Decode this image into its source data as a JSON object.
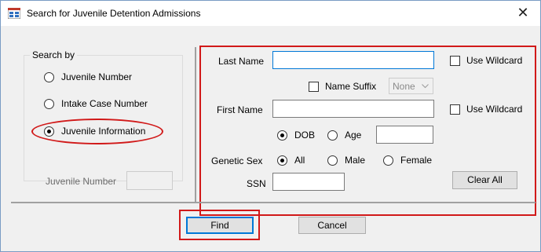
{
  "window": {
    "title": "Search for Juvenile Detention Admissions",
    "close_glyph": "✕"
  },
  "search_by": {
    "legend": "Search by",
    "options": [
      {
        "label": "Juvenile Number",
        "checked": false
      },
      {
        "label": "Intake Case Number",
        "checked": false
      },
      {
        "label": "Juvenile Information",
        "checked": true
      }
    ],
    "juvenile_number_label": "Juvenile Number",
    "juvenile_number_value": ""
  },
  "info": {
    "last_name_label": "Last Name",
    "last_name_value": "",
    "use_wildcard_label": "Use Wildcard",
    "name_suffix_label": "Name Suffix",
    "name_suffix_value": "None",
    "first_name_label": "First Name",
    "first_name_value": "",
    "dob_label": "DOB",
    "age_label": "Age",
    "dob_age_value": "",
    "genetic_sex_label": "Genetic Sex",
    "sex_options": [
      "All",
      "Male",
      "Female"
    ],
    "ssn_label": "SSN",
    "ssn_value": "",
    "clear_all_label": "Clear All"
  },
  "footer": {
    "find_label": "Find",
    "cancel_label": "Cancel"
  },
  "colors": {
    "annotation": "#d11919",
    "focus": "#0078d7"
  },
  "icons": {
    "app": "app-window-icon",
    "close": "close-icon",
    "dropdown": "chevron-down-icon"
  }
}
